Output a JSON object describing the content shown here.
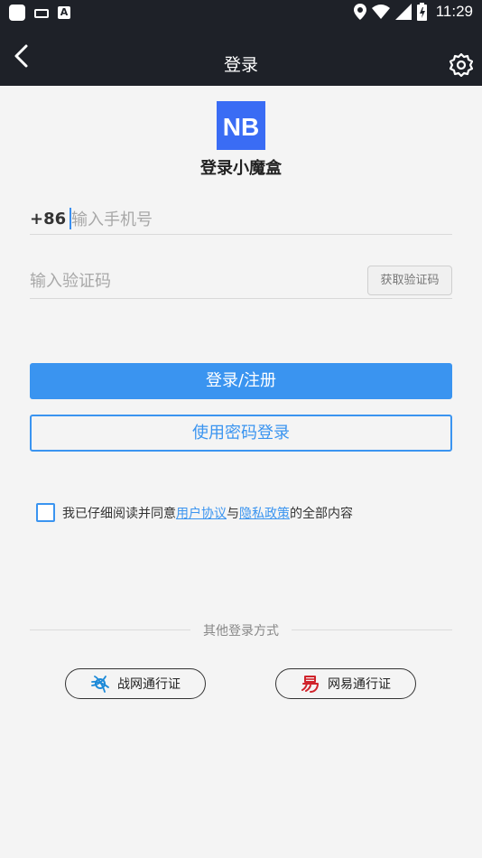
{
  "status_bar": {
    "time": "11:29"
  },
  "header": {
    "title": "登录"
  },
  "app": {
    "logo_text": "NB",
    "name": "登录小魔盒"
  },
  "form": {
    "country_code": "+86",
    "phone_placeholder": "输入手机号",
    "phone_value": "",
    "code_placeholder": "输入验证码",
    "code_value": "",
    "get_code_label": "获取验证码"
  },
  "buttons": {
    "login_register": "登录/注册",
    "password_login": "使用密码登录"
  },
  "agreement": {
    "prefix": "我已仔细阅读并同意",
    "user_agreement": "用户协议",
    "and": "与",
    "privacy_policy": "隐私政策",
    "suffix": "的全部内容",
    "checked": false
  },
  "other_login": {
    "label": "其他登录方式",
    "battlenet": "战网通行证",
    "netease": "网易通行证"
  },
  "colors": {
    "accent": "#3a94f0",
    "topbar": "#1e2128",
    "logo": "#3a6cf4",
    "netease": "#d0232b"
  }
}
